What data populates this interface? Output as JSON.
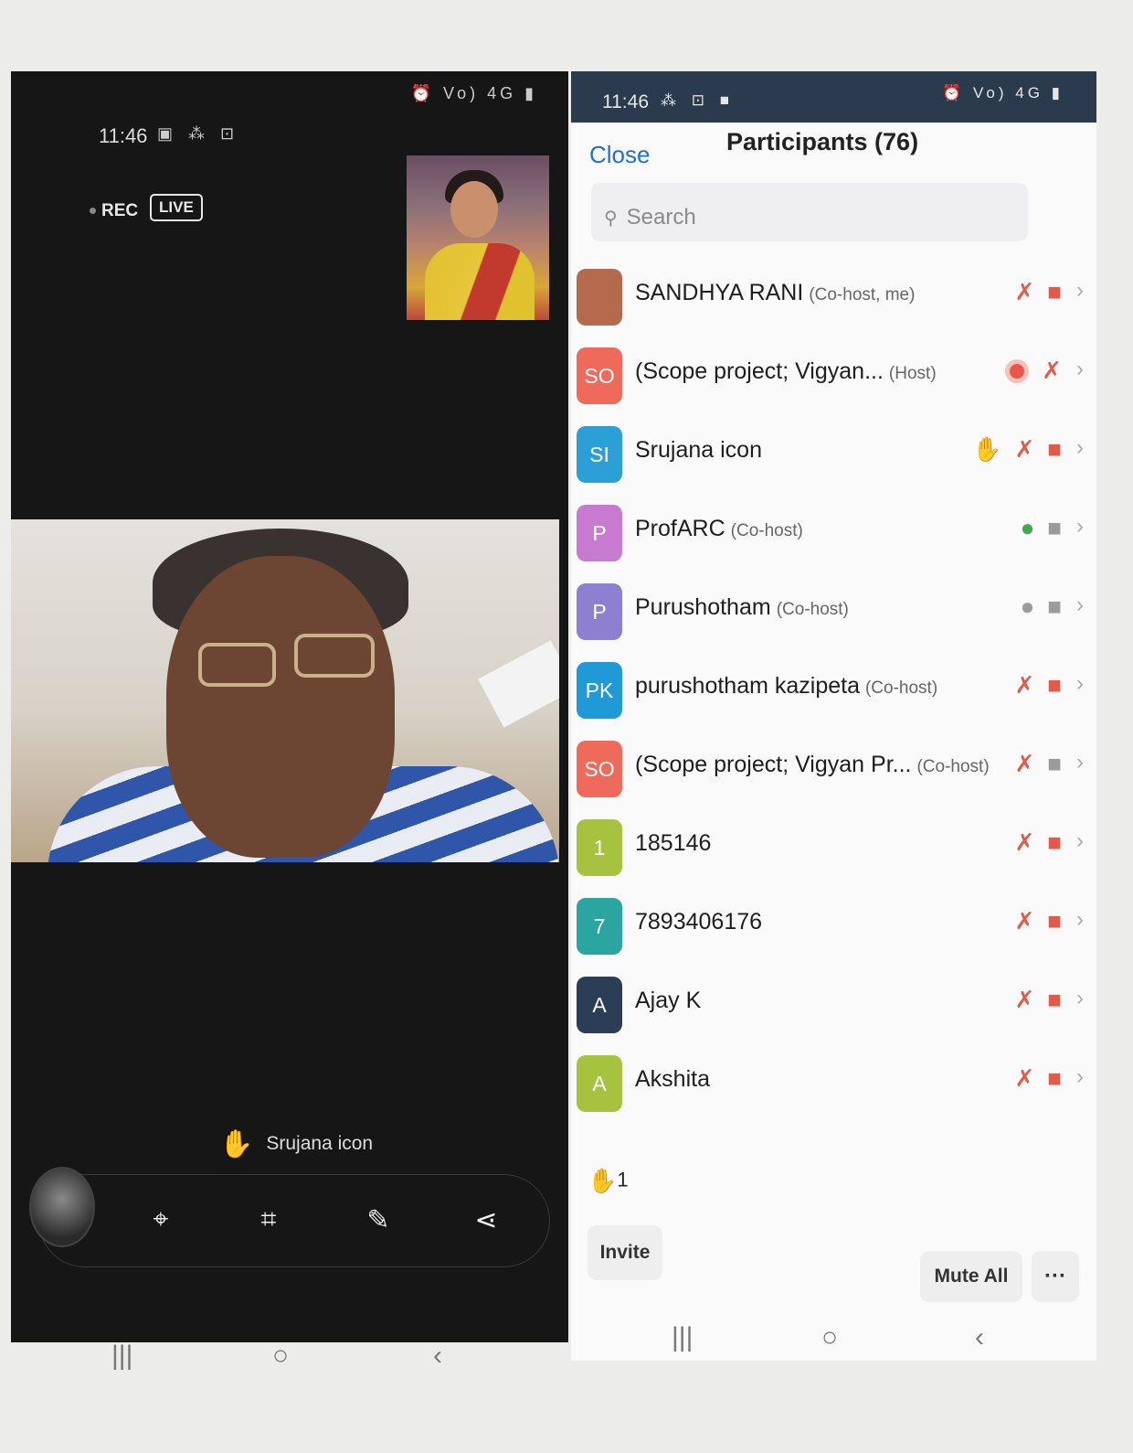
{
  "left": {
    "time": "11:46",
    "status_left_icons": "▣ ⁂ ⊡",
    "status_right_icons": "⏰ Vo) 4G ▮",
    "rec_label": "REC",
    "live_label": "LIVE",
    "raised_hand_name": "Srujana icon",
    "toolbar_icons": [
      "scan-icon",
      "crop-icon",
      "pen-icon",
      "share-icon"
    ]
  },
  "right": {
    "time": "11:46",
    "status_left_icons": "⁂ ⊡ ■",
    "status_right_icons": "⏰ Vo) 4G ▮",
    "close_label": "Close",
    "title": "Participants (76)",
    "search_placeholder": "Search",
    "participants": [
      {
        "initials": "",
        "name": "SANDHYA RANI",
        "role": "(Co-host, me)",
        "color": "#b56a4e",
        "icons": [
          "mic-off",
          "cam-off"
        ]
      },
      {
        "initials": "SO",
        "name": "(Scope project; Vigyan...",
        "role": "(Host)",
        "color": "#ef6a5a",
        "icons": [
          "recording",
          "mic-off"
        ]
      },
      {
        "initials": "SI",
        "name": "Srujana icon",
        "role": "",
        "color": "#2c9fd6",
        "icons": [
          "hand",
          "mic-off",
          "cam-off"
        ]
      },
      {
        "initials": "P",
        "name": "ProfARC",
        "role": "(Co-host)",
        "color": "#c77ad0",
        "icons": [
          "mic-on",
          "cam-on"
        ]
      },
      {
        "initials": "P",
        "name": "Purushotham",
        "role": "(Co-host)",
        "color": "#8f7fd0",
        "icons": [
          "mic-on-grey",
          "cam-on"
        ]
      },
      {
        "initials": "PK",
        "name": "purushotham kazipeta",
        "role": "(Co-host)",
        "color": "#1f9ad6",
        "icons": [
          "mic-off",
          "cam-off"
        ]
      },
      {
        "initials": "SO",
        "name": "(Scope project; Vigyan Pr...",
        "role": "(Co-host)",
        "color": "#ef6a5a",
        "icons": [
          "mic-off",
          "cam-on"
        ]
      },
      {
        "initials": "1",
        "name": "185146",
        "role": "",
        "color": "#a6c23e",
        "icons": [
          "mic-off",
          "cam-off"
        ]
      },
      {
        "initials": "7",
        "name": "7893406176",
        "role": "",
        "color": "#2aa5a0",
        "icons": [
          "mic-off",
          "cam-off"
        ]
      },
      {
        "initials": "A",
        "name": "Ajay K",
        "role": "",
        "color": "#2c3e55",
        "icons": [
          "mic-off",
          "cam-off"
        ]
      },
      {
        "initials": "A",
        "name": "Akshita",
        "role": "",
        "color": "#a6c23e",
        "icons": [
          "mic-off",
          "cam-off"
        ]
      }
    ],
    "raised_count": "1",
    "invite_label": "Invite",
    "mute_all_label": "Mute All",
    "more_label": "···"
  },
  "nav": {
    "recent": "|||",
    "home": "○",
    "back": "‹"
  }
}
